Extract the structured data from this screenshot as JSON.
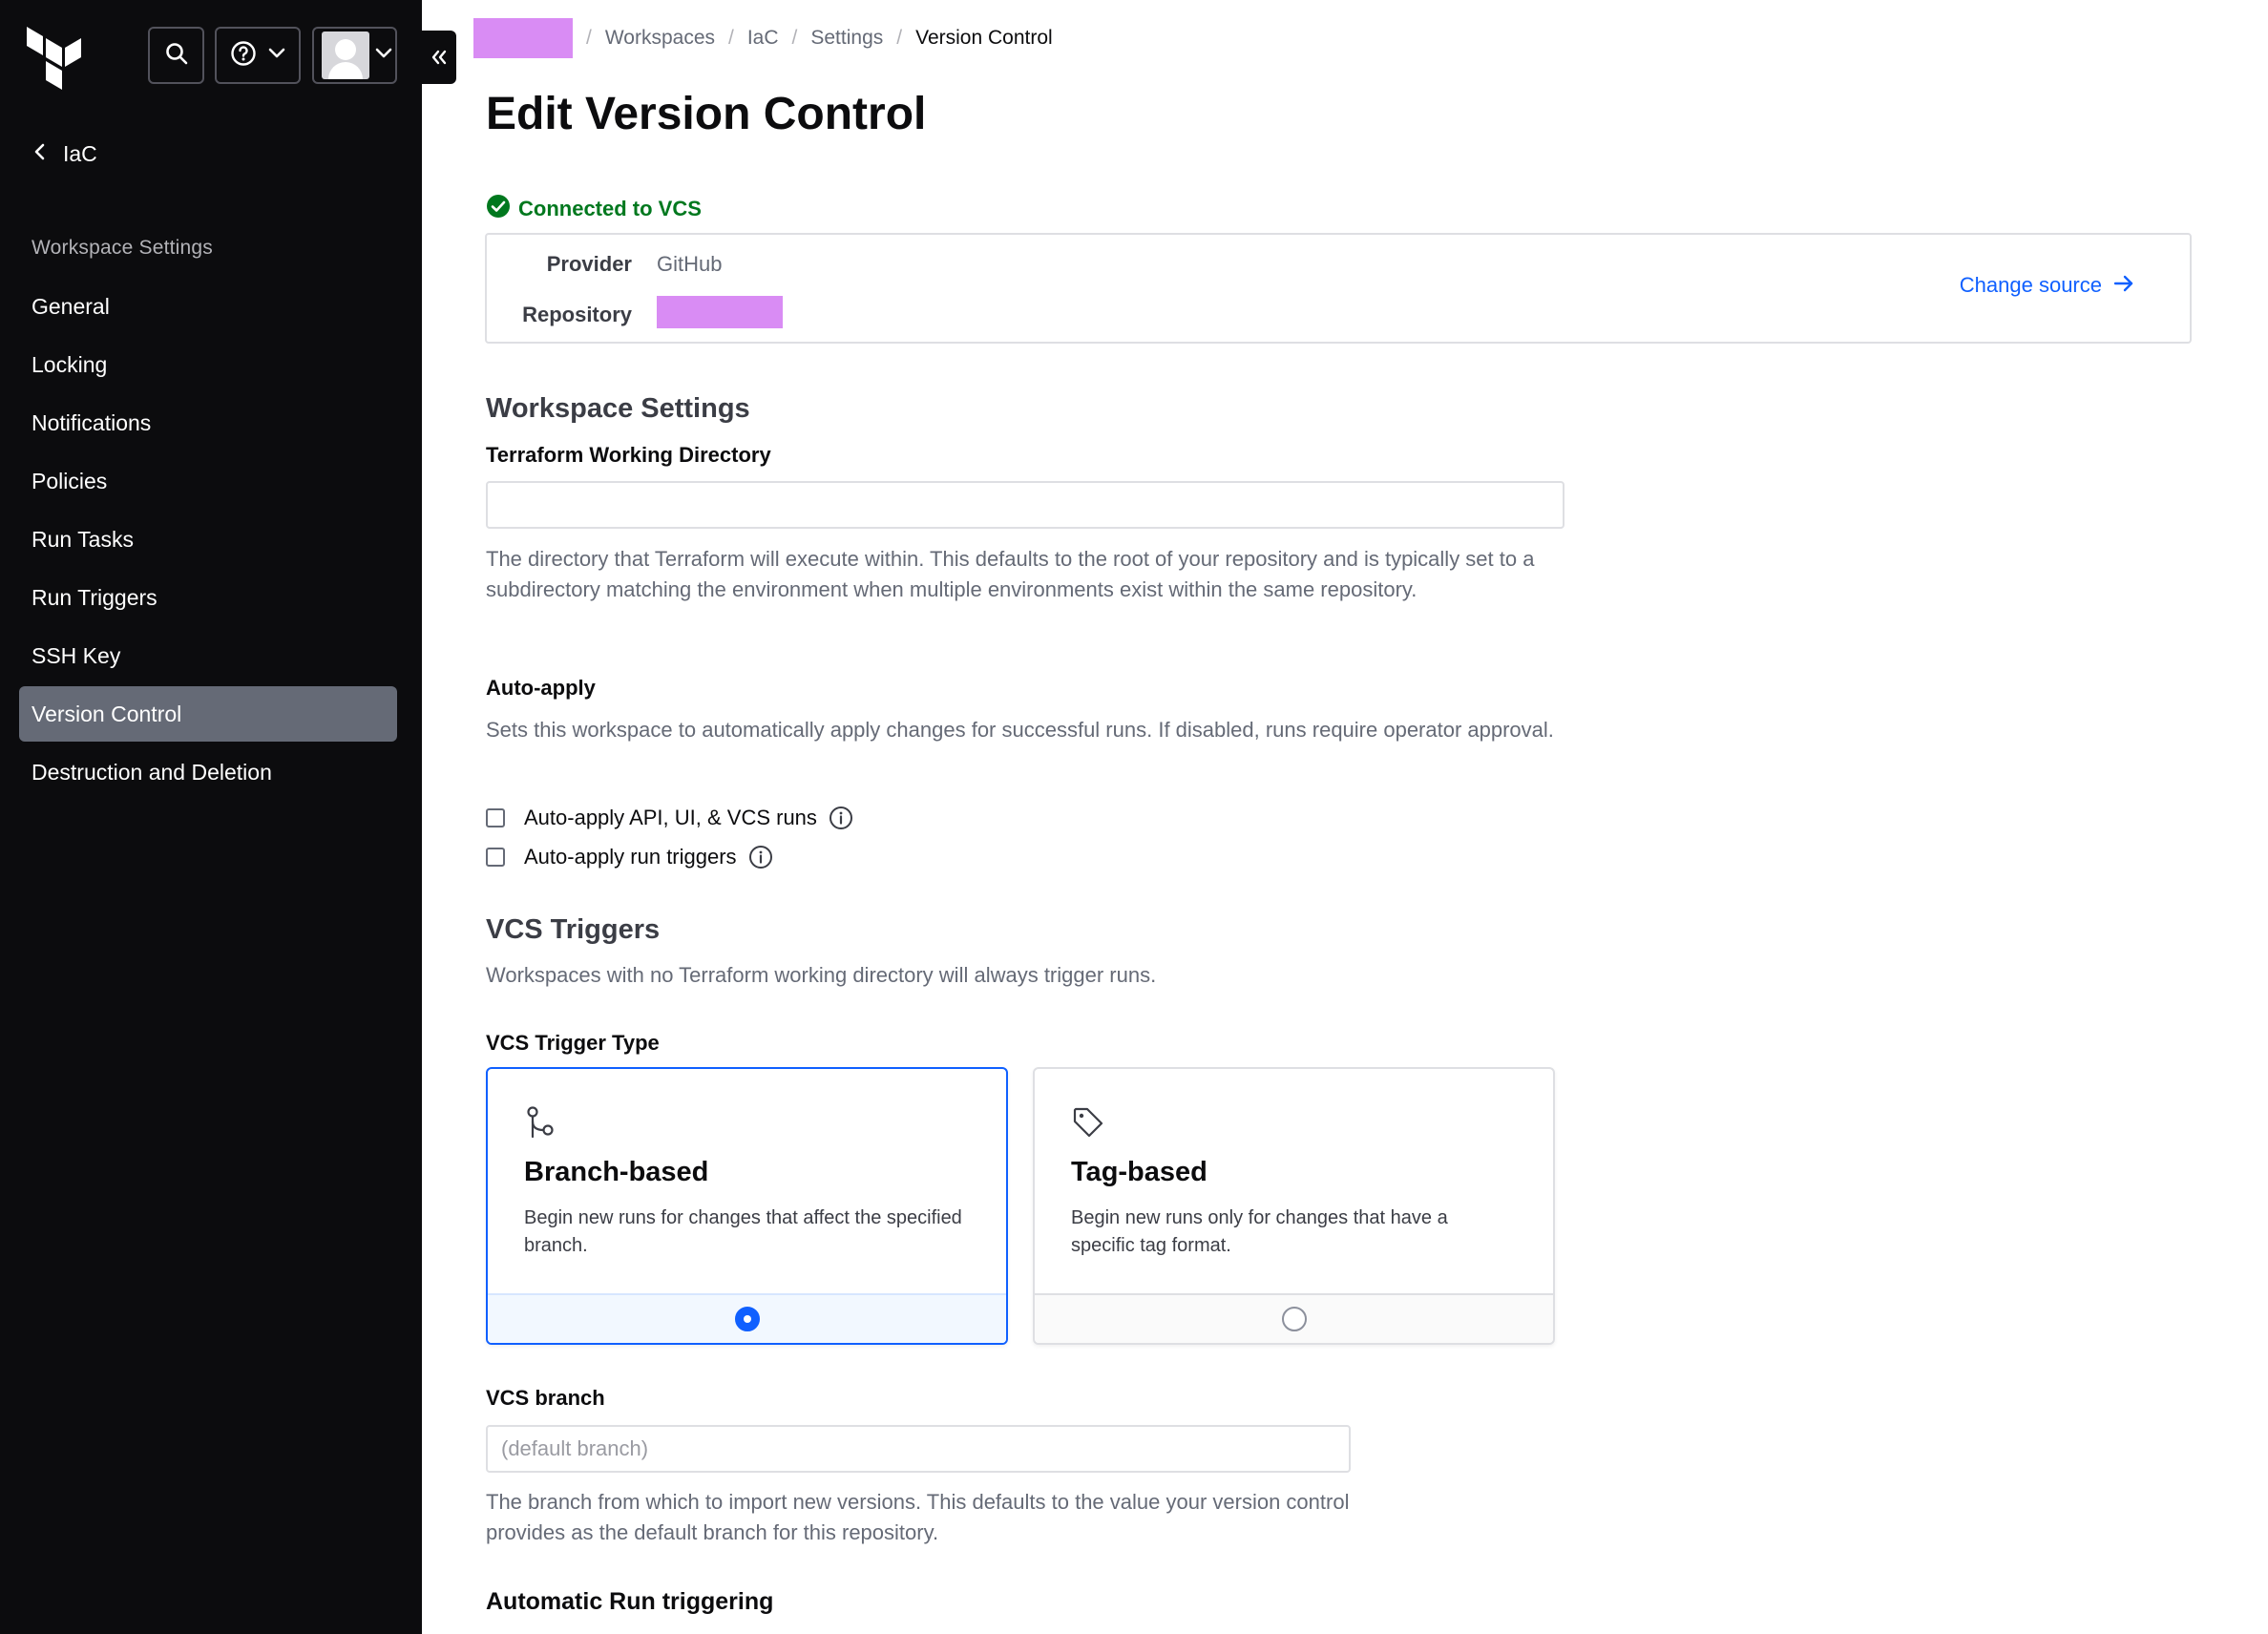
{
  "colors": {
    "sidebar_bg": "#0c0c0e",
    "active_nav": "#656a76",
    "accent_blue": "#1060ff",
    "success_green": "#00781e",
    "redaction": "#d98cf4"
  },
  "sidebar": {
    "logo": "terraform-logo-icon",
    "back_label": "IaC",
    "heading": "Workspace Settings",
    "items": [
      {
        "label": "General"
      },
      {
        "label": "Locking"
      },
      {
        "label": "Notifications"
      },
      {
        "label": "Policies"
      },
      {
        "label": "Run Tasks"
      },
      {
        "label": "Run Triggers"
      },
      {
        "label": "SSH Key"
      },
      {
        "label": "Version Control",
        "active": true
      },
      {
        "label": "Destruction and Deletion"
      }
    ]
  },
  "breadcrumb": {
    "items": [
      "Workspaces",
      "IaC",
      "Settings"
    ],
    "current": "Version Control",
    "separator": "/"
  },
  "page": {
    "title": "Edit Version Control"
  },
  "vcs": {
    "status": "Connected to VCS",
    "provider_label": "Provider",
    "provider_value": "GitHub",
    "repository_label": "Repository",
    "change_source": "Change source"
  },
  "workspace_settings": {
    "title": "Workspace Settings",
    "working_dir_label": "Terraform Working Directory",
    "working_dir_value": "",
    "working_dir_help": "The directory that Terraform will execute within. This defaults to the root of your repository and is typically set to a subdirectory matching the environment when multiple environments exist within the same repository.",
    "auto_apply_label": "Auto-apply",
    "auto_apply_help": "Sets this workspace to automatically apply changes for successful runs. If disabled, runs require operator approval.",
    "auto_apply_api": "Auto-apply API, UI, & VCS runs",
    "auto_apply_triggers": "Auto-apply run triggers"
  },
  "vcs_triggers": {
    "title": "VCS Triggers",
    "help": "Workspaces with no Terraform working directory will always trigger runs.",
    "type_label": "VCS Trigger Type",
    "branch_title": "Branch-based",
    "branch_desc": "Begin new runs for changes that affect the specified branch.",
    "tag_title": "Tag-based",
    "tag_desc": "Begin new runs only for changes that have a specific tag format.",
    "selected": "branch"
  },
  "vcs_branch": {
    "label": "VCS branch",
    "placeholder": "(default branch)",
    "help": "The branch from which to import new versions. This defaults to the value your version control provides as the default branch for this repository."
  },
  "auto_run": {
    "title": "Automatic Run triggering"
  }
}
